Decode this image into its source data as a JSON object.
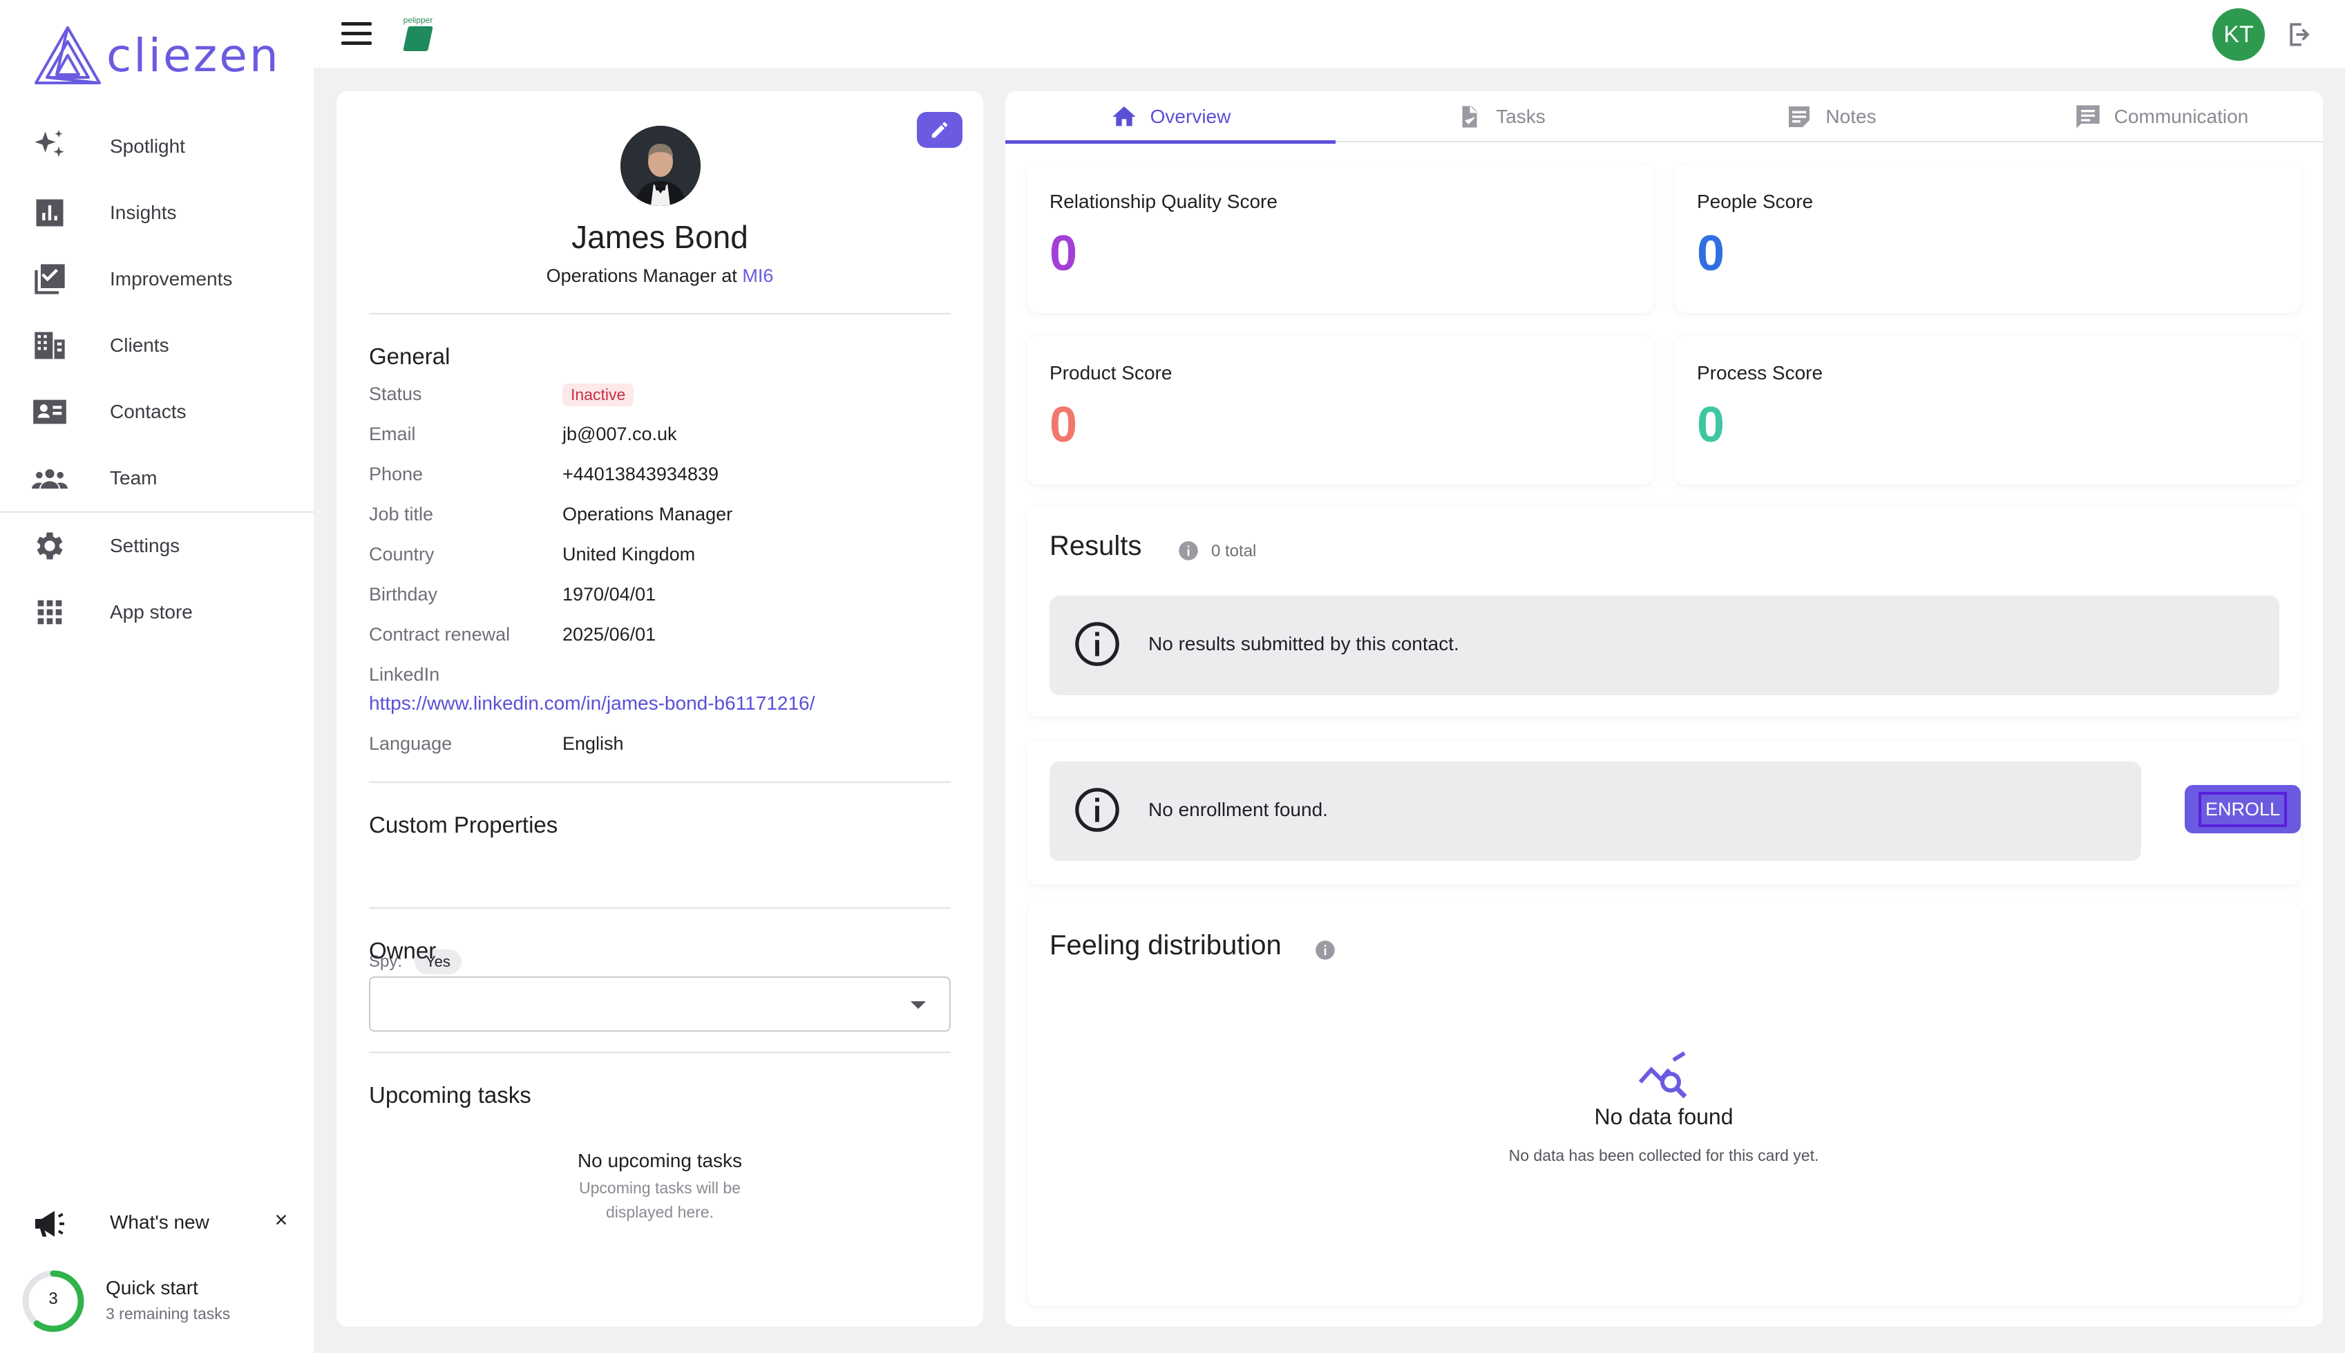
{
  "app": {
    "name": "cliezen",
    "brand_mini": "pelipper"
  },
  "user": {
    "initials": "KT"
  },
  "colors": {
    "accent": "#6a5be0",
    "inactive": "#c8303e",
    "success_ring": "#2fb34a"
  },
  "sidebar": {
    "items": [
      {
        "label": "Spotlight",
        "icon": "sparkles-icon"
      },
      {
        "label": "Insights",
        "icon": "bar-chart-icon"
      },
      {
        "label": "Improvements",
        "icon": "checklist-icon"
      },
      {
        "label": "Clients",
        "icon": "building-icon"
      },
      {
        "label": "Contacts",
        "icon": "contact-card-icon"
      },
      {
        "label": "Team",
        "icon": "team-icon"
      },
      {
        "label": "Settings",
        "icon": "gear-icon"
      },
      {
        "label": "App store",
        "icon": "grid-icon"
      }
    ],
    "whats_new": "What's new",
    "close": "×",
    "quick_start": {
      "title": "Quick start",
      "subtitle": "3 remaining tasks",
      "count": "3",
      "progress": 0.6
    }
  },
  "profile": {
    "name": "James Bond",
    "role_prefix": "Operations Manager at ",
    "company": "MI6",
    "general_title": "General",
    "fields": {
      "status_label": "Status",
      "status_value": "Inactive",
      "email_label": "Email",
      "email_value": "jb@007.co.uk",
      "phone_label": "Phone",
      "phone_value": "+44013843934839",
      "job_label": "Job title",
      "job_value": "Operations Manager",
      "country_label": "Country",
      "country_value": "United Kingdom",
      "birthday_label": "Birthday",
      "birthday_value": "1970/04/01",
      "renewal_label": "Contract renewal",
      "renewal_value": "2025/06/01",
      "linkedin_label": "LinkedIn",
      "linkedin_value": "https://www.linkedin.com/in/james-bond-b61171216/",
      "language_label": "Language",
      "language_value": "English"
    },
    "custom_title": "Custom Properties",
    "custom": {
      "label": "Spy:",
      "value": "Yes"
    },
    "owner_title": "Owner",
    "owner_value": "",
    "tasks_title": "Upcoming tasks",
    "tasks_empty_title": "No upcoming tasks",
    "tasks_empty_sub": "Upcoming tasks will be displayed here."
  },
  "tabs": [
    {
      "label": "Overview",
      "icon": "home-icon"
    },
    {
      "label": "Tasks",
      "icon": "task-doc-icon"
    },
    {
      "label": "Notes",
      "icon": "notes-icon"
    },
    {
      "label": "Communication",
      "icon": "chat-icon"
    }
  ],
  "scores": [
    {
      "label": "Relationship Quality Score",
      "value": "0",
      "color": "#a23fd6"
    },
    {
      "label": "People Score",
      "value": "0",
      "color": "#2f6fe0"
    },
    {
      "label": "Product Score",
      "value": "0",
      "color": "#f0766e"
    },
    {
      "label": "Process Score",
      "value": "0",
      "color": "#3ec6a0"
    }
  ],
  "results": {
    "title": "Results",
    "total": "0 total",
    "empty": "No results submitted by this contact."
  },
  "enrollment": {
    "empty": "No enrollment found.",
    "button": "ENROLL"
  },
  "feeling": {
    "title": "Feeling distribution",
    "nodata_title": "No data found",
    "nodata_sub": "No data has been collected for this card yet."
  }
}
